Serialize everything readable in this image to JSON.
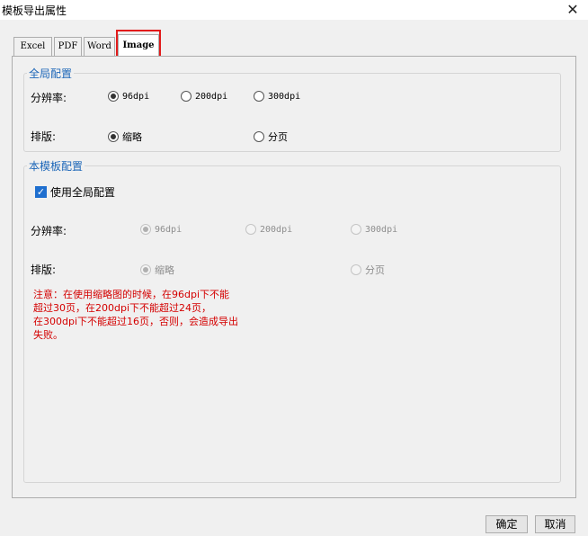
{
  "window": {
    "title": "模板导出属性"
  },
  "tabs": [
    {
      "label": "Excel"
    },
    {
      "label": "PDF"
    },
    {
      "label": "Word"
    },
    {
      "label": "Image"
    }
  ],
  "global": {
    "legend": "全局配置",
    "resolution_label": "分辨率:",
    "resolution_options": [
      "96dpi",
      "200dpi",
      "300dpi"
    ],
    "resolution_selected": "96dpi",
    "layout_label": "排版:",
    "layout_options": [
      "缩略",
      "分页"
    ],
    "layout_selected": "缩略"
  },
  "template": {
    "legend": "本模板配置",
    "use_global_label": "使用全局配置",
    "use_global_checked": true,
    "resolution_label": "分辨率:",
    "resolution_options": [
      "96dpi",
      "200dpi",
      "300dpi"
    ],
    "resolution_selected": "96dpi",
    "layout_label": "排版:",
    "layout_options": [
      "缩略",
      "分页"
    ],
    "layout_selected": "缩略"
  },
  "notice": "注意：在使用缩略图的时候，在96dpi下不能\n超过30页，在200dpi下不能超过24页，\n在300dpi下不能超过16页，否则，会造成导出\n失败。",
  "buttons": {
    "ok": "确定",
    "cancel": "取消"
  },
  "colors": {
    "legend": "#1c66b8",
    "notice": "#d40000",
    "highlight": "#e21b1b",
    "checkbox": "#1f6fcf"
  }
}
